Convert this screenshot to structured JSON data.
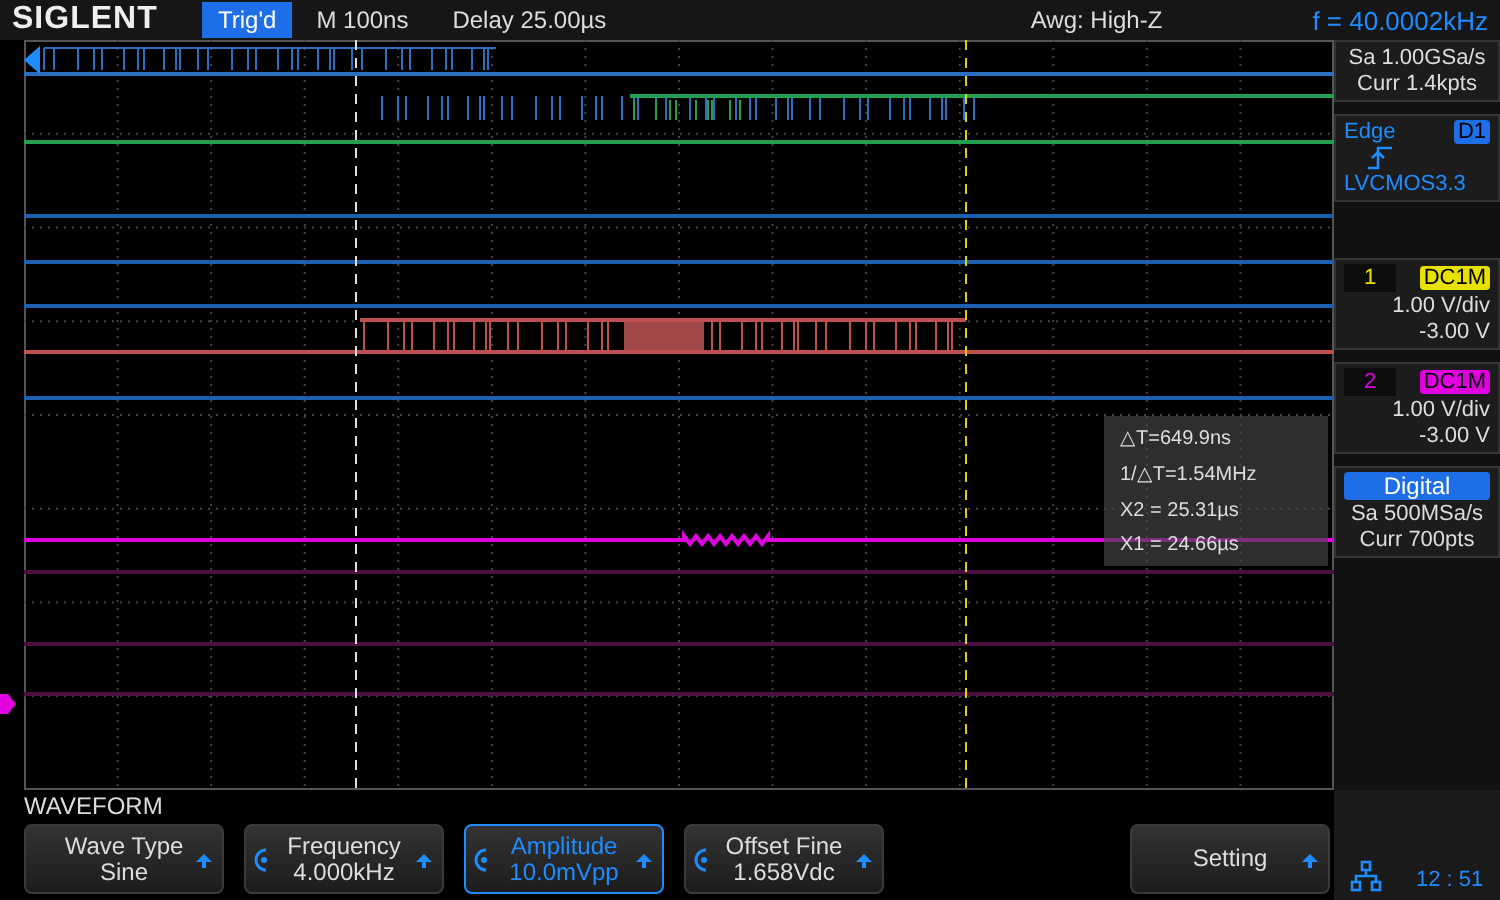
{
  "header": {
    "brand": "SIGLENT",
    "trigger_status": "Trig'd",
    "timebase": "M 100ns",
    "delay": "Delay 25.00µs",
    "impedance": "Awg: High-Z",
    "frequency": "f = 40.0002kHz"
  },
  "acquisition": {
    "sample_rate": "Sa 1.00GSa/s",
    "memory": "Curr 1.4kpts"
  },
  "trigger": {
    "type": "Edge",
    "source": "D1",
    "level": "LVCMOS3.3"
  },
  "channels": [
    {
      "number": "1",
      "coupling": "DC1M",
      "scale": "1.00 V/div",
      "offset": "-3.00 V",
      "color": "#e8e000"
    },
    {
      "number": "2",
      "coupling": "DC1M",
      "scale": "1.00 V/div",
      "offset": "-3.00 V",
      "color": "#e000e0"
    }
  ],
  "digital": {
    "title": "Digital",
    "sample_rate": "Sa 500MSa/s",
    "memory": "Curr 700pts"
  },
  "cursor_readout": [
    "△T=649.9ns",
    "1/△T=1.54MHz",
    "X2 = 25.31µs",
    "X1 = 24.66µs"
  ],
  "menu": {
    "title": "WAVEFORM",
    "buttons": [
      {
        "kind": "plain",
        "label": "Wave Type",
        "value": "Sine",
        "selected": false
      },
      {
        "kind": "knob",
        "label": "Frequency",
        "value": "4.000kHz",
        "selected": false
      },
      {
        "kind": "knob",
        "label": "Amplitude",
        "value": "10.0mVpp",
        "selected": true
      },
      {
        "kind": "knob",
        "label": "Offset Fine",
        "value": "1.658Vdc",
        "selected": false
      },
      {
        "kind": "plain",
        "label": "Setting",
        "selected": false
      }
    ]
  },
  "status": {
    "time": "12 : 51"
  }
}
